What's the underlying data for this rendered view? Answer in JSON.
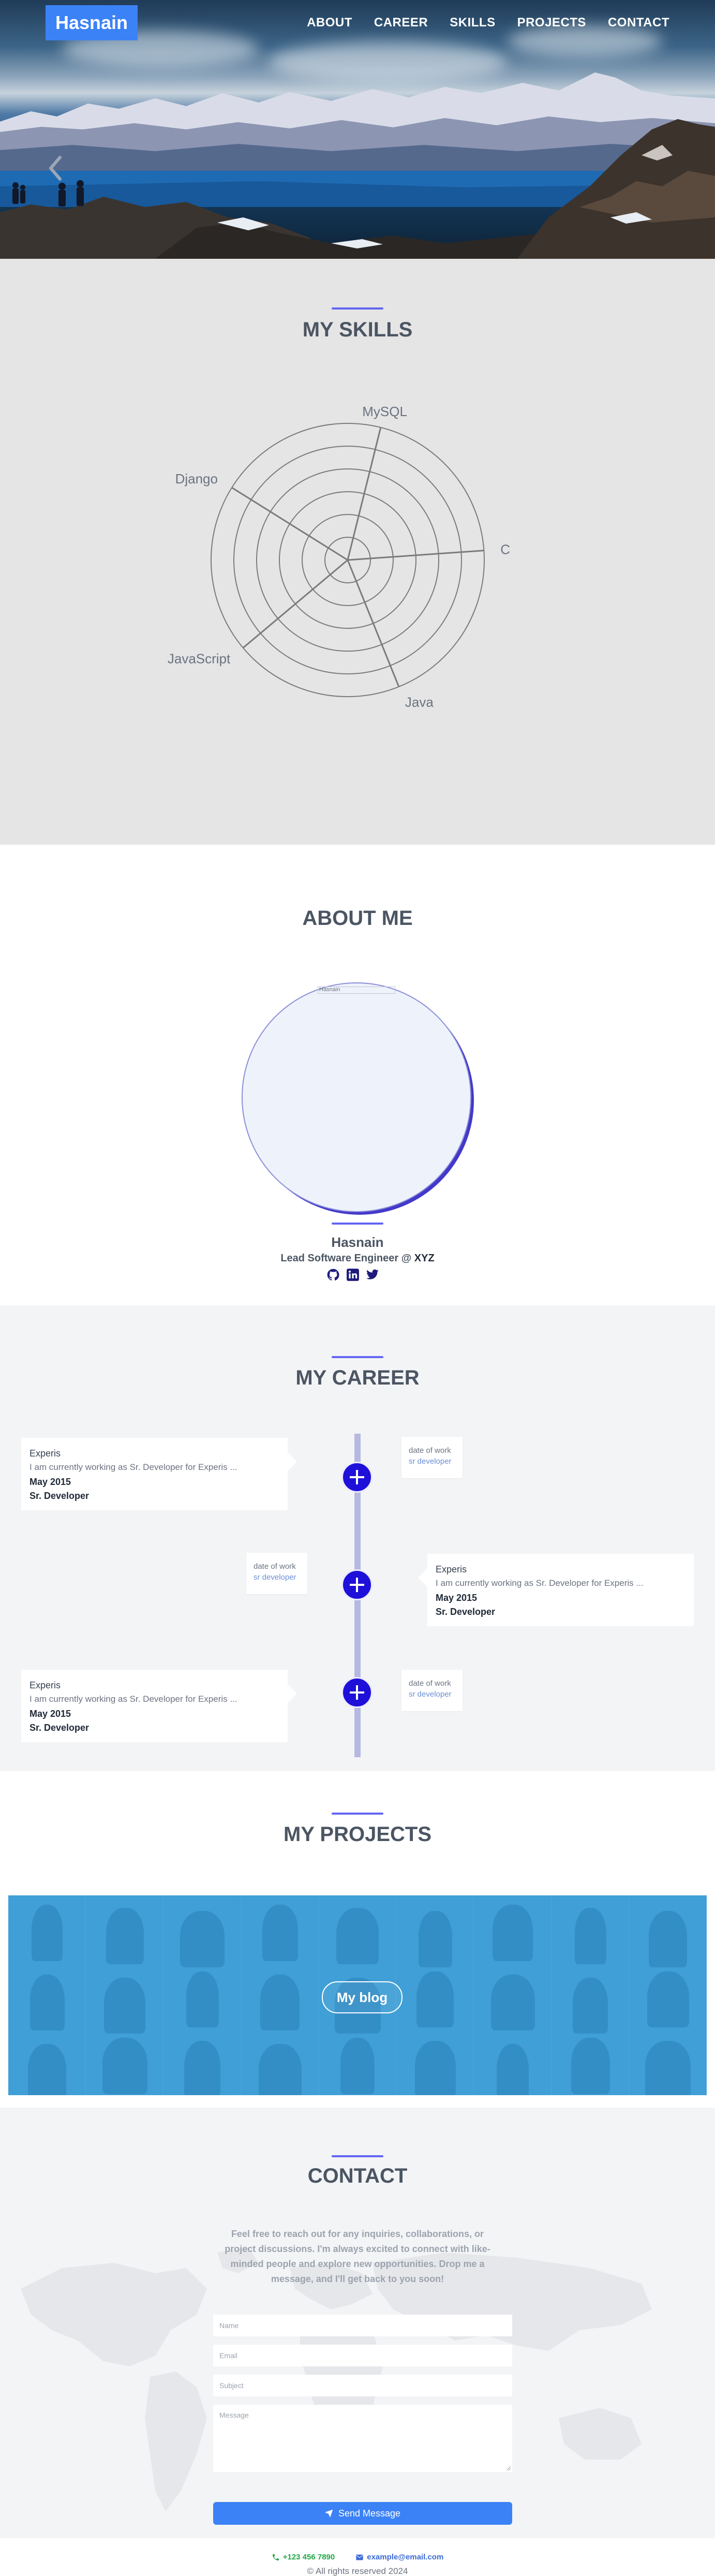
{
  "brand": {
    "name": "Hasnain"
  },
  "nav": {
    "items": [
      "ABOUT",
      "CAREER",
      "SKILLS",
      "PROJECTS",
      "CONTACT"
    ]
  },
  "skills": {
    "title": "MY SKILLS",
    "chart_data": {
      "type": "radar",
      "axes": [
        "MySQL",
        "C",
        "Java",
        "JavaScript",
        "Django"
      ],
      "rings": 6,
      "values": []
    }
  },
  "about": {
    "title": "ABOUT ME",
    "image_alt": "Hasnain",
    "name": "Hasnain",
    "role": "Lead Software Engineer @ ",
    "company": "XYZ",
    "socials": [
      "github-icon",
      "linkedin-icon",
      "twitter-icon"
    ]
  },
  "career": {
    "title": "MY CAREER",
    "entries": [
      {
        "company": "Experis",
        "desc": "I am currently working as Sr. Developer for Experis ...",
        "date": "May 2015",
        "title": "Sr. Developer",
        "date_label": "date of work",
        "role_label": "sr developer"
      },
      {
        "company": "Experis",
        "desc": "I am currently working as Sr. Developer for Experis ...",
        "date": "May 2015",
        "title": "Sr. Developer",
        "date_label": "date of work",
        "role_label": "sr developer"
      },
      {
        "company": "Experis",
        "desc": "I am currently working as Sr. Developer for Experis ...",
        "date": "May 2015",
        "title": "Sr. Developer",
        "date_label": "date of work",
        "role_label": "sr developer"
      }
    ]
  },
  "projects": {
    "title": "MY PROJECTS",
    "button": "My blog"
  },
  "contact": {
    "title": "CONTACT",
    "text": "Feel free to reach out for any inquiries, collaborations, or project discussions. I'm always excited to connect with like-minded people and explore new opportunities. Drop me a message, and I'll get back to you soon!",
    "name_placeholder": "Name",
    "email_placeholder": "Email",
    "subject_placeholder": "Subject",
    "message_placeholder": "Message",
    "send_label": "Send Message"
  },
  "footer": {
    "phone": "+123 456 7890",
    "email": "example@email.com",
    "copyright": "© All rights reserved 2024"
  },
  "colors": {
    "accent": "#3b82f6",
    "indigo": "#6366f1",
    "timeline_node": "#1e10d8",
    "projects_bg": "#3f9fd6"
  }
}
